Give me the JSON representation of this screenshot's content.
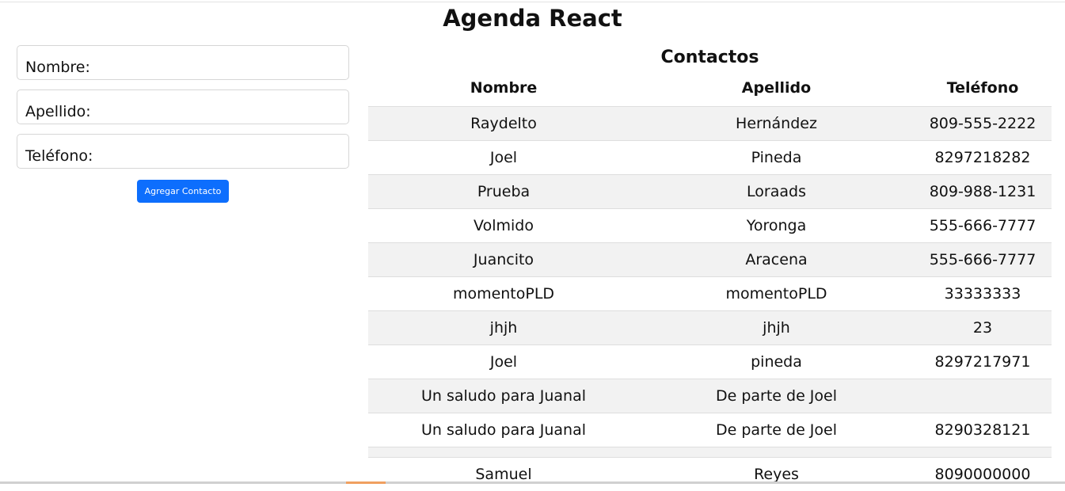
{
  "app": {
    "title": "Agenda React"
  },
  "form": {
    "name_label": "Nombre:",
    "lastname_label": "Apellido:",
    "phone_label": "Teléfono:",
    "submit_label": "Agregar Contacto"
  },
  "contacts": {
    "title": "Contactos",
    "columns": [
      "Nombre",
      "Apellido",
      "Teléfono"
    ],
    "rows": [
      [
        "Raydelto",
        "Hernández",
        "809-555-2222"
      ],
      [
        "Joel",
        "Pineda",
        "8297218282"
      ],
      [
        "Prueba",
        "Loraads",
        "809-988-1231"
      ],
      [
        "Volmido",
        "Yoronga",
        "555-666-7777"
      ],
      [
        "Juancito",
        "Aracena",
        "555-666-7777"
      ],
      [
        "momentoPLD",
        "momentoPLD",
        "33333333"
      ],
      [
        "jhjh",
        "jhjh",
        "23"
      ],
      [
        "Joel",
        "pineda",
        "8297217971"
      ],
      [
        "Un saludo para Juanal",
        "De parte de Joel",
        ""
      ],
      [
        "Un saludo para Juanal",
        "De parte de Joel",
        "8290328121"
      ],
      [
        "",
        "",
        ""
      ],
      [
        "Samuel",
        "Reyes",
        "8090000000"
      ]
    ]
  },
  "colors": {
    "accent": "#0d6efd",
    "stripe": "#f2f2f2"
  }
}
